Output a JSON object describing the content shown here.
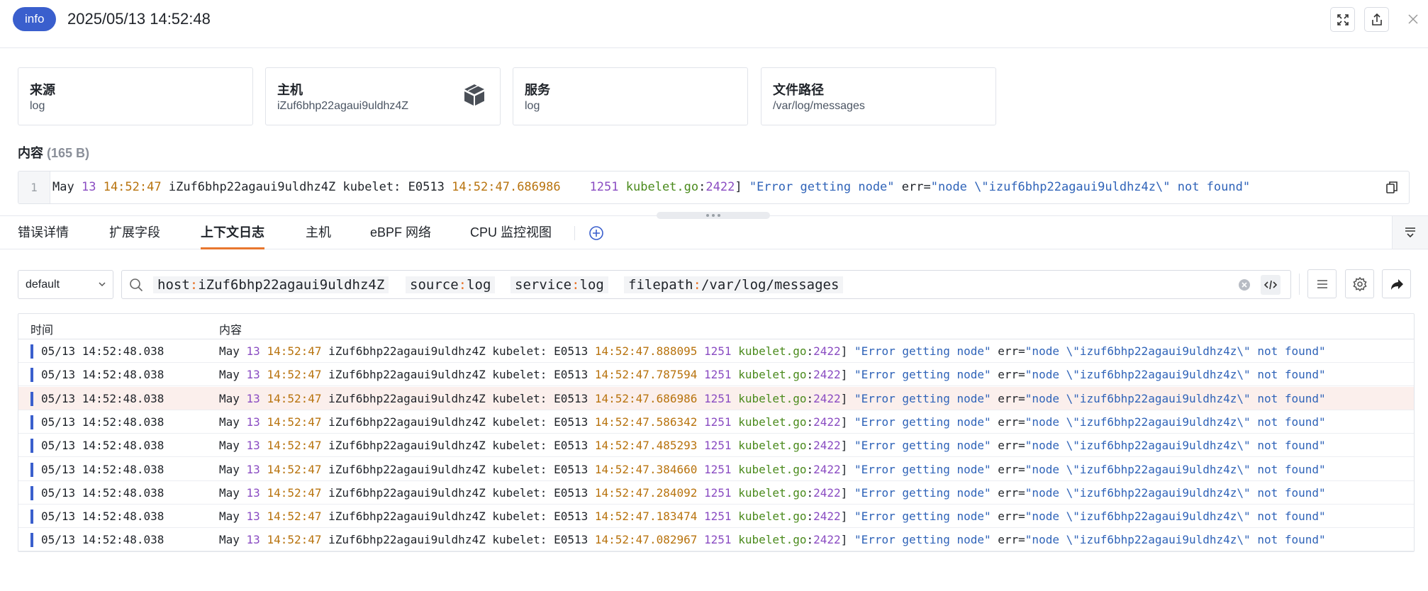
{
  "header": {
    "badge": "info",
    "title": "2025/05/13 14:52:48",
    "icons": [
      "fullscreen-icon",
      "share-icon",
      "close-icon"
    ]
  },
  "cards": [
    {
      "label": "来源",
      "value": "log"
    },
    {
      "label": "主机",
      "value": "iZuf6bhp22agaui9uldhz4Z",
      "icon": "box-icon"
    },
    {
      "label": "服务",
      "value": "log"
    },
    {
      "label": "文件路径",
      "value": "/var/log/messages"
    }
  ],
  "content": {
    "title": "内容",
    "size": "(165 B)",
    "line_no": "1",
    "line": {
      "month": "May",
      "day": "13",
      "time": "14:52:47",
      "host": "iZuf6bhp22agaui9uldhz4Z",
      "proc": "kubelet:",
      "code": "E0513",
      "ts": "14:52:47.686986",
      "pid": "1251",
      "file": "kubelet.go",
      "colon": ":",
      "lineno": "2422",
      "bracket": "]",
      "msg": "\"Error getting node\"",
      "errkey": "err=",
      "errval": "\"node \\\"izuf6bhp22agaui9uldhz4z\\\" not found\""
    }
  },
  "tabs": [
    {
      "label": "错误详情"
    },
    {
      "label": "扩展字段"
    },
    {
      "label": "上下文日志",
      "active": true
    },
    {
      "label": "主机"
    },
    {
      "label": "eBPF 网络"
    },
    {
      "label": "CPU 监控视图"
    }
  ],
  "filter": {
    "select": "default",
    "chips": [
      {
        "key": "host",
        "val": "iZuf6bhp22agaui9uldhz4Z"
      },
      {
        "key": "source",
        "val": "log"
      },
      {
        "key": "service",
        "val": "log"
      },
      {
        "key": "filepath",
        "val": "/var/log/messages"
      }
    ]
  },
  "table": {
    "col_time": "时间",
    "col_content": "内容",
    "rows": [
      {
        "time": "05/13 14:52:48.038",
        "ts": "14:52:47.888095"
      },
      {
        "time": "05/13 14:52:48.038",
        "ts": "14:52:47.787594"
      },
      {
        "time": "05/13 14:52:48.038",
        "ts": "14:52:47.686986",
        "highlight": true
      },
      {
        "time": "05/13 14:52:48.038",
        "ts": "14:52:47.586342"
      },
      {
        "time": "05/13 14:52:48.038",
        "ts": "14:52:47.485293"
      },
      {
        "time": "05/13 14:52:48.038",
        "ts": "14:52:47.384660"
      },
      {
        "time": "05/13 14:52:48.038",
        "ts": "14:52:47.284092"
      },
      {
        "time": "05/13 14:52:48.038",
        "ts": "14:52:47.183474"
      },
      {
        "time": "05/13 14:52:48.038",
        "ts": "14:52:47.082967"
      }
    ]
  },
  "colors": {
    "accent": "#3a5fcd",
    "tab_active": "#e8772e",
    "number": "#8a4cc2",
    "time": "#b8730e",
    "file": "#4a8a1c",
    "string": "#2f63b8"
  }
}
